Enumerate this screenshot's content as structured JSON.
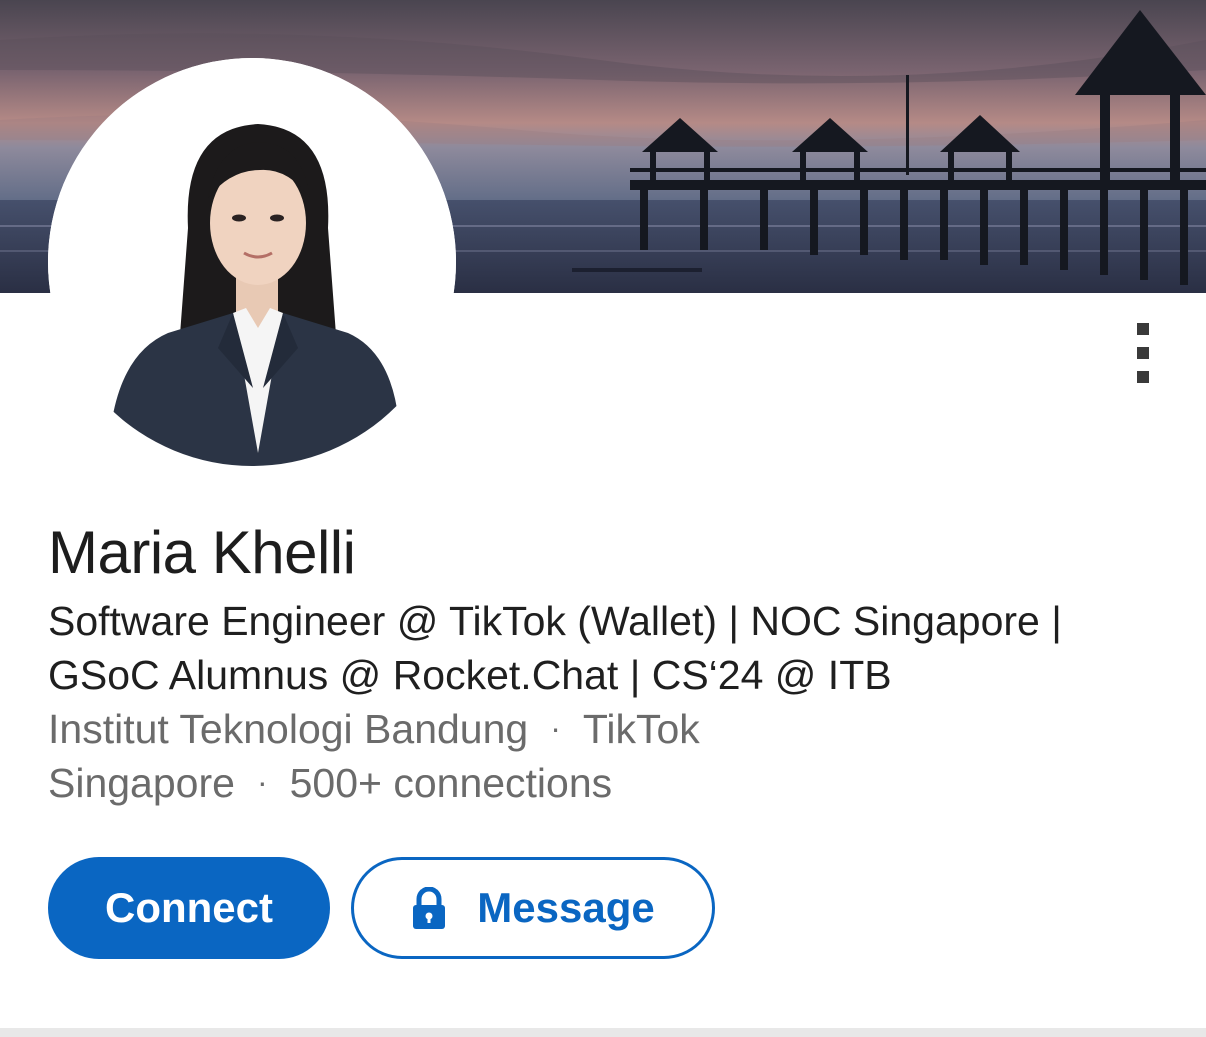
{
  "profile": {
    "name": "Maria Khelli",
    "headline": "Software Engineer @ TikTok (Wallet) | NOC Singapore | GSoC Alumnus @ Rocket.Chat | CS‘24 @ ITB",
    "education": "Institut Teknologi Bandung",
    "company": "TikTok",
    "location": "Singapore",
    "connections": "500+ connections",
    "separator": "·"
  },
  "actions": {
    "connect_label": "Connect",
    "message_label": "Message"
  },
  "icons": {
    "more": "more-vertical-icon",
    "lock": "lock-icon"
  },
  "colors": {
    "brand_blue": "#0a66c2",
    "name_text": "#1d1d1d",
    "secondary_text": "#6b6b6b"
  }
}
